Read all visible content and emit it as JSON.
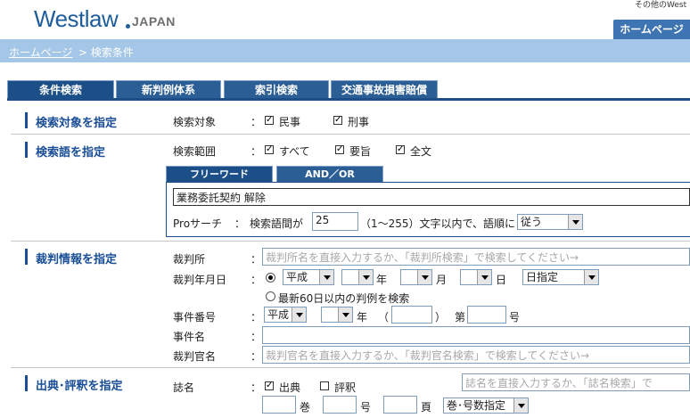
{
  "header": {
    "logo_main": "Westlaw",
    "logo_sub": "JAPAN",
    "other_link": "その他のWest",
    "home_button": "ホームページ"
  },
  "breadcrumb": {
    "home": "ホームページ",
    "current": " > 検索条件"
  },
  "tabs": [
    "条件検索",
    "新判例体系",
    "索引検索",
    "交通事故損害賠償"
  ],
  "target": {
    "title": "検索対象を指定",
    "label": "検索対象",
    "opt1": "民事",
    "opt2": "刑事"
  },
  "keyword": {
    "title": "検索語を指定",
    "range_label": "検索範囲",
    "opt_all": "すべて",
    "opt_summary": "要旨",
    "opt_full": "全文",
    "tab_free": "フリーワード",
    "tab_andor": "AND／OR",
    "query": "業務委託契約 解除",
    "pro_label": "Proサーチ",
    "pro_prefix": "検索語間が",
    "pro_value": "25",
    "pro_suffix": "（1～255）文字以内で、語順に",
    "order_select": "従う"
  },
  "court": {
    "title": "裁判情報を指定",
    "court_label": "裁判所",
    "court_placeholder": "裁判所名を直接入力するか、「裁判所検索」で検索してください→",
    "date_label": "裁判年月日",
    "era": "平成",
    "year_unit": "年",
    "month_unit": "月",
    "day_unit": "日",
    "date_mode": "日指定",
    "recent_label": "最新60日以内の判例を検索",
    "case_no_label": "事件番号",
    "case_era": "平成",
    "case_year_unit": "年",
    "paren_open": "（",
    "paren_close": "）",
    "dai": "第",
    "gou": "号",
    "case_name_label": "事件名",
    "judge_label": "裁判官名",
    "judge_placeholder": "裁判官名を直接入力するか、「裁判官名検索」で検索してください→"
  },
  "source": {
    "title": "出典･評釈を指定",
    "journal_label": "誌名",
    "opt_source": "出典",
    "opt_review": "評釈",
    "journal_placeholder": "誌名を直接入力するか、「誌名検索」で",
    "vol_unit": "巻",
    "no_unit": "号",
    "page_unit": "頁",
    "spec_select": "巻･号数指定"
  },
  "colon": "："
}
